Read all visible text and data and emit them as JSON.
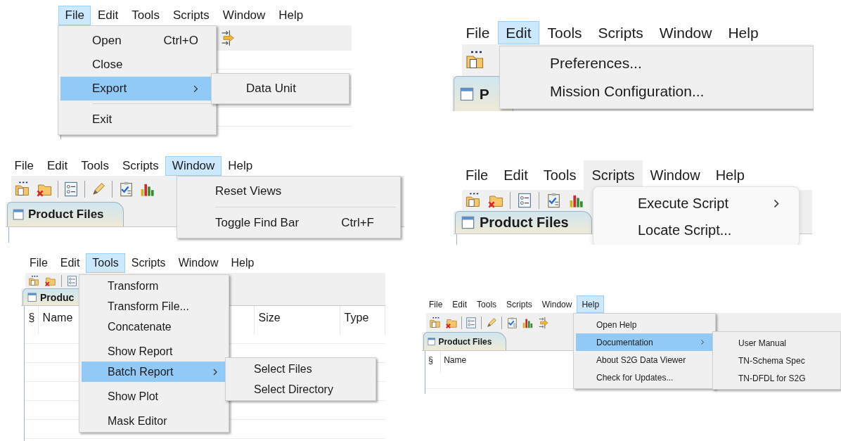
{
  "panels": [
    {
      "menubar": [
        {
          "label": "File",
          "selected": true
        },
        {
          "label": "Edit",
          "selected": false
        },
        {
          "label": "Tools",
          "selected": false
        },
        {
          "label": "Scripts",
          "selected": false
        },
        {
          "label": "Window",
          "selected": false
        },
        {
          "label": "Help",
          "selected": false
        }
      ],
      "menu": [
        {
          "kind": "item",
          "label": "Open",
          "shortcut": "Ctrl+O",
          "has_submenu": false,
          "selected": false
        },
        {
          "kind": "item",
          "label": "Close",
          "has_submenu": false,
          "selected": false
        },
        {
          "kind": "item",
          "label": "Export",
          "has_submenu": true,
          "selected": true
        },
        {
          "kind": "separator"
        },
        {
          "kind": "item",
          "label": "Exit",
          "has_submenu": false,
          "selected": false
        }
      ],
      "submenu": [
        {
          "label": "Data Unit",
          "selected": false
        }
      ]
    },
    {
      "menubar": [
        {
          "label": "File",
          "selected": false
        },
        {
          "label": "Edit",
          "selected": true
        },
        {
          "label": "Tools",
          "selected": false
        },
        {
          "label": "Scripts",
          "selected": false
        },
        {
          "label": "Window",
          "selected": false
        },
        {
          "label": "Help",
          "selected": false
        }
      ],
      "tab": {
        "label": "P"
      },
      "menu": [
        {
          "kind": "item",
          "label": "Preferences...",
          "has_submenu": false,
          "selected": false
        },
        {
          "kind": "item",
          "label": "Mission Configuration...",
          "has_submenu": false,
          "selected": false
        }
      ]
    },
    {
      "menubar": [
        {
          "label": "File",
          "selected": false
        },
        {
          "label": "Edit",
          "selected": false
        },
        {
          "label": "Tools",
          "selected": false
        },
        {
          "label": "Scripts",
          "selected": false
        },
        {
          "label": "Window",
          "selected": true
        },
        {
          "label": "Help",
          "selected": false
        }
      ],
      "tab": {
        "label": "Product Files"
      },
      "menu": [
        {
          "kind": "item",
          "label": "Reset Views",
          "has_submenu": false,
          "selected": false
        },
        {
          "kind": "separator"
        },
        {
          "kind": "item",
          "label": "Toggle Find Bar",
          "shortcut": "Ctrl+F",
          "has_submenu": false,
          "selected": false
        }
      ]
    },
    {
      "menubar": [
        {
          "label": "File",
          "selected": false
        },
        {
          "label": "Edit",
          "selected": false
        },
        {
          "label": "Tools",
          "selected": false
        },
        {
          "label": "Scripts",
          "selected": true
        },
        {
          "label": "Window",
          "selected": false
        },
        {
          "label": "Help",
          "selected": false
        }
      ],
      "tab": {
        "label": "Product Files"
      },
      "menu": [
        {
          "kind": "item",
          "label": "Execute Script",
          "has_submenu": true,
          "selected": false
        },
        {
          "kind": "item",
          "label": "Locate Script...",
          "has_submenu": false,
          "selected": false
        }
      ]
    },
    {
      "menubar": [
        {
          "label": "File",
          "selected": false
        },
        {
          "label": "Edit",
          "selected": false
        },
        {
          "label": "Tools",
          "selected": true
        },
        {
          "label": "Scripts",
          "selected": false
        },
        {
          "label": "Window",
          "selected": false
        },
        {
          "label": "Help",
          "selected": false
        }
      ],
      "tab": {
        "label": "Produc"
      },
      "table_columns": [
        "§",
        "Name",
        "Size",
        "Type"
      ],
      "menu": [
        {
          "kind": "item",
          "label": "Transform",
          "has_submenu": false,
          "selected": false
        },
        {
          "kind": "item",
          "label": "Transform File...",
          "has_submenu": false,
          "selected": false
        },
        {
          "kind": "item",
          "label": "Concatenate",
          "has_submenu": false,
          "selected": false
        },
        {
          "kind": "separator"
        },
        {
          "kind": "item",
          "label": "Show Report",
          "has_submenu": false,
          "selected": false
        },
        {
          "kind": "item",
          "label": "Batch Report",
          "has_submenu": true,
          "selected": true
        },
        {
          "kind": "separator"
        },
        {
          "kind": "item",
          "label": "Show Plot",
          "has_submenu": false,
          "selected": false
        },
        {
          "kind": "separator"
        },
        {
          "kind": "item",
          "label": "Mask Editor",
          "has_submenu": false,
          "selected": false
        }
      ],
      "submenu": [
        {
          "label": "Select Files",
          "selected": false
        },
        {
          "label": "Select Directory",
          "selected": false
        }
      ]
    },
    {
      "menubar": [
        {
          "label": "File",
          "selected": false
        },
        {
          "label": "Edit",
          "selected": false
        },
        {
          "label": "Tools",
          "selected": false
        },
        {
          "label": "Scripts",
          "selected": false
        },
        {
          "label": "Window",
          "selected": false
        },
        {
          "label": "Help",
          "selected": true
        }
      ],
      "tab": {
        "label": "Product Files"
      },
      "table_columns": [
        "§",
        "Name"
      ],
      "menu": [
        {
          "kind": "item",
          "label": "Open Help",
          "has_submenu": false,
          "selected": false
        },
        {
          "kind": "item",
          "label": "Documentation",
          "has_submenu": true,
          "selected": true
        },
        {
          "kind": "item",
          "label": "About S2G Data Viewer",
          "has_submenu": false,
          "selected": false
        },
        {
          "kind": "item",
          "label": "Check for Updates...",
          "has_submenu": false,
          "selected": false
        }
      ],
      "submenu": [
        {
          "label": "User Manual",
          "selected": false
        },
        {
          "label": "TN-Schema Spec",
          "selected": false
        },
        {
          "label": "TN-DFDL for S2G",
          "selected": false
        }
      ]
    }
  ]
}
